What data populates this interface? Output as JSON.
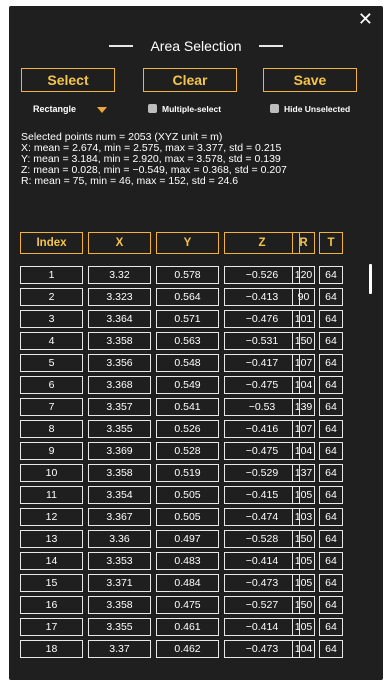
{
  "window": {
    "title": "Area Selection",
    "close_glyph": "✕"
  },
  "toolbar": {
    "select_label": "Select",
    "clear_label": "Clear",
    "save_label": "Save"
  },
  "options": {
    "shape": "Rectangle",
    "multiple_select_label": "Multiple-select",
    "multiple_select_checked": false,
    "hide_unselected_label": "Hide Unselected",
    "hide_unselected_checked": false
  },
  "stats": {
    "selected": "Selected points num = 2053 (XYZ unit = m)",
    "x": "X: mean = 2.674, min = 2.575, max = 3.377, std = 0.215",
    "y": "Y: mean = 3.184, min = 2.920, max = 3.578, std = 0.139",
    "z": "Z: mean = 0.028, min = −0.549, max = 0.368, std = 0.207",
    "r": "R: mean = 75, min = 46, max = 152, std = 24.6"
  },
  "table": {
    "headers": [
      "Index",
      "X",
      "Y",
      "Z",
      "R",
      "T"
    ],
    "rows": [
      [
        "1",
        "3.32",
        "0.578",
        "−0.526",
        "120",
        "64"
      ],
      [
        "2",
        "3.323",
        "0.564",
        "−0.413",
        "90",
        "64"
      ],
      [
        "3",
        "3.364",
        "0.571",
        "−0.476",
        "101",
        "64"
      ],
      [
        "4",
        "3.358",
        "0.563",
        "−0.531",
        "150",
        "64"
      ],
      [
        "5",
        "3.356",
        "0.548",
        "−0.417",
        "107",
        "64"
      ],
      [
        "6",
        "3.368",
        "0.549",
        "−0.475",
        "104",
        "64"
      ],
      [
        "7",
        "3.357",
        "0.541",
        "−0.53",
        "139",
        "64"
      ],
      [
        "8",
        "3.355",
        "0.526",
        "−0.416",
        "107",
        "64"
      ],
      [
        "9",
        "3.369",
        "0.528",
        "−0.475",
        "104",
        "64"
      ],
      [
        "10",
        "3.358",
        "0.519",
        "−0.529",
        "137",
        "64"
      ],
      [
        "11",
        "3.354",
        "0.505",
        "−0.415",
        "105",
        "64"
      ],
      [
        "12",
        "3.367",
        "0.505",
        "−0.474",
        "103",
        "64"
      ],
      [
        "13",
        "3.36",
        "0.497",
        "−0.528",
        "150",
        "64"
      ],
      [
        "14",
        "3.353",
        "0.483",
        "−0.414",
        "105",
        "64"
      ],
      [
        "15",
        "3.371",
        "0.484",
        "−0.473",
        "105",
        "64"
      ],
      [
        "16",
        "3.358",
        "0.475",
        "−0.527",
        "150",
        "64"
      ],
      [
        "17",
        "3.355",
        "0.461",
        "−0.414",
        "105",
        "64"
      ],
      [
        "18",
        "3.37",
        "0.462",
        "−0.473",
        "104",
        "64"
      ]
    ]
  },
  "colors": {
    "background": "#1f1f1f",
    "accent": "#f6c44a",
    "border": "#e8e8e8"
  }
}
